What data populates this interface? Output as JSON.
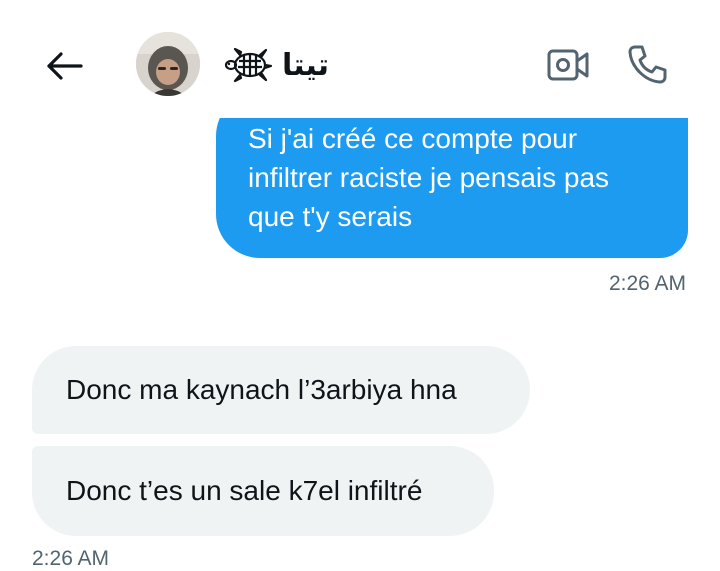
{
  "header": {
    "contact_name": "تيتا",
    "back_icon": "arrow-left-icon",
    "name_emoji": "turtle-icon",
    "video_icon": "video-camera-icon",
    "call_icon": "phone-icon"
  },
  "messages": [
    {
      "direction": "outgoing",
      "lines": [
        "Si j'ai créé ce compte pour",
        "infiltrer raciste je pensais pas",
        "que t'y serais"
      ],
      "time": "2:26 AM"
    },
    {
      "direction": "incoming",
      "text": "Donc ma kaynach l’3arbiya hna"
    },
    {
      "direction": "incoming",
      "text": "Donc t’es un sale k7el infiltré",
      "time": "2:26 AM"
    }
  ],
  "colors": {
    "outgoing_bubble": "#1d9bf0",
    "incoming_bubble": "#eff3f4",
    "timestamp": "#536471",
    "icon": "#536471"
  }
}
